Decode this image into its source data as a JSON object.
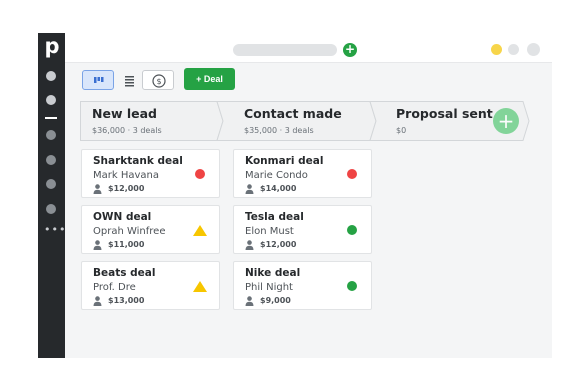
{
  "colors": {
    "sidebar": "#26292c",
    "brand_green": "#25a244",
    "status_red": "#ef4444",
    "status_green": "#25a244",
    "status_yellow": "#f7c600"
  },
  "sidebar": {
    "logo": "p",
    "more": "•••"
  },
  "topbar": {
    "add_icon": "+"
  },
  "toolbar": {
    "views": [
      "pipeline-view-icon",
      "list-view-icon",
      "forecast-view-icon"
    ],
    "add_deal_label": "+ Deal"
  },
  "stages": [
    {
      "title": "New lead",
      "summary": "$36,000 · 3 deals"
    },
    {
      "title": "Contact made",
      "summary": "$35,000 · 3 deals"
    },
    {
      "title": "Proposal sent",
      "summary": "$0"
    }
  ],
  "drop_zone": {
    "icon": "+"
  },
  "deals": [
    {
      "title": "Sharktank deal",
      "person": "Mark Havana",
      "value": "$12,000",
      "status": "red"
    },
    {
      "title": "OWN deal",
      "person": "Oprah Winfree",
      "value": "$11,000",
      "status": "warning"
    },
    {
      "title": "Beats deal",
      "person": "Prof. Dre",
      "value": "$13,000",
      "status": "warning"
    },
    {
      "title": "Konmari deal",
      "person": "Marie Condo",
      "value": "$14,000",
      "status": "red"
    },
    {
      "title": "Tesla deal",
      "person": "Elon Must",
      "value": "$12,000",
      "status": "green"
    },
    {
      "title": "Nike deal",
      "person": "Phil Night",
      "value": "$9,000",
      "status": "green"
    }
  ]
}
